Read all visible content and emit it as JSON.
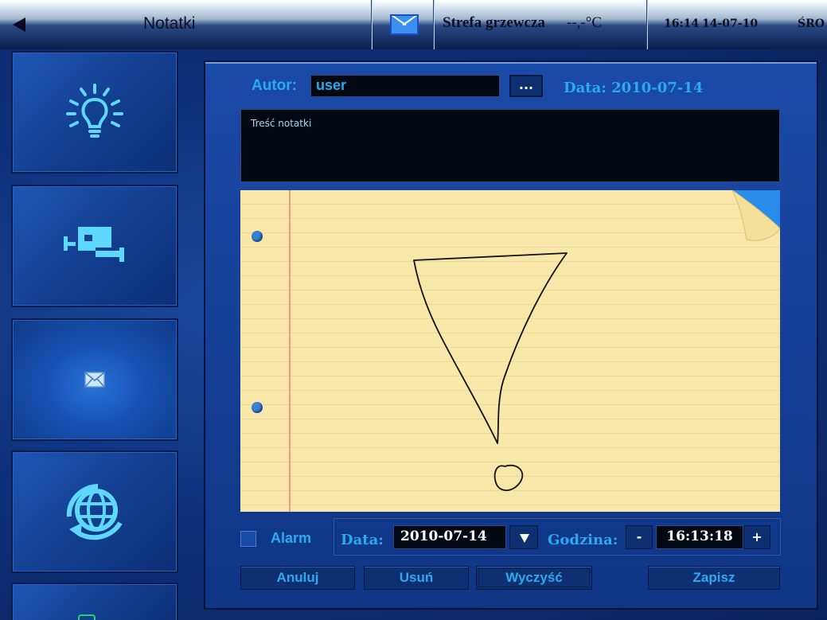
{
  "header": {
    "back_icon": "back-arrow-icon",
    "title": "Notatki",
    "mail_icon": "envelope-icon",
    "zone_label": "Strefa grzewcza",
    "zone_temp": "--,-°C",
    "time": "16:14",
    "date": "14-07-10",
    "day": "ŚRO"
  },
  "sidebar": {
    "items": [
      {
        "name": "lighting",
        "icon": "light-bulb-icon"
      },
      {
        "name": "monitoring",
        "icon": "security-camera-icon"
      },
      {
        "name": "notes",
        "icon": "envelope-icon",
        "active": true
      },
      {
        "name": "internet",
        "icon": "globe-icon"
      }
    ]
  },
  "form": {
    "author_label": "Autor:",
    "author_value": "user",
    "browse_label": "...",
    "date_label": "Data: 2010-07-14",
    "note_placeholder": "Treść notatki",
    "alarm_label": "Alarm",
    "alarm_checked": false,
    "alarm_date_label": "Data:",
    "alarm_date_value": "2010-07-14",
    "time_label": "Godzina:",
    "time_minus": "-",
    "time_value": "16:13:18",
    "time_plus": "+"
  },
  "actions": {
    "cancel": "Anuluj",
    "delete": "Usuń",
    "clear": "Wyczyść",
    "save": "Zapisz"
  },
  "colors": {
    "accent": "#2aaaf0",
    "panel": "#1a4aa8",
    "note_paper": "#f8e7a8"
  }
}
